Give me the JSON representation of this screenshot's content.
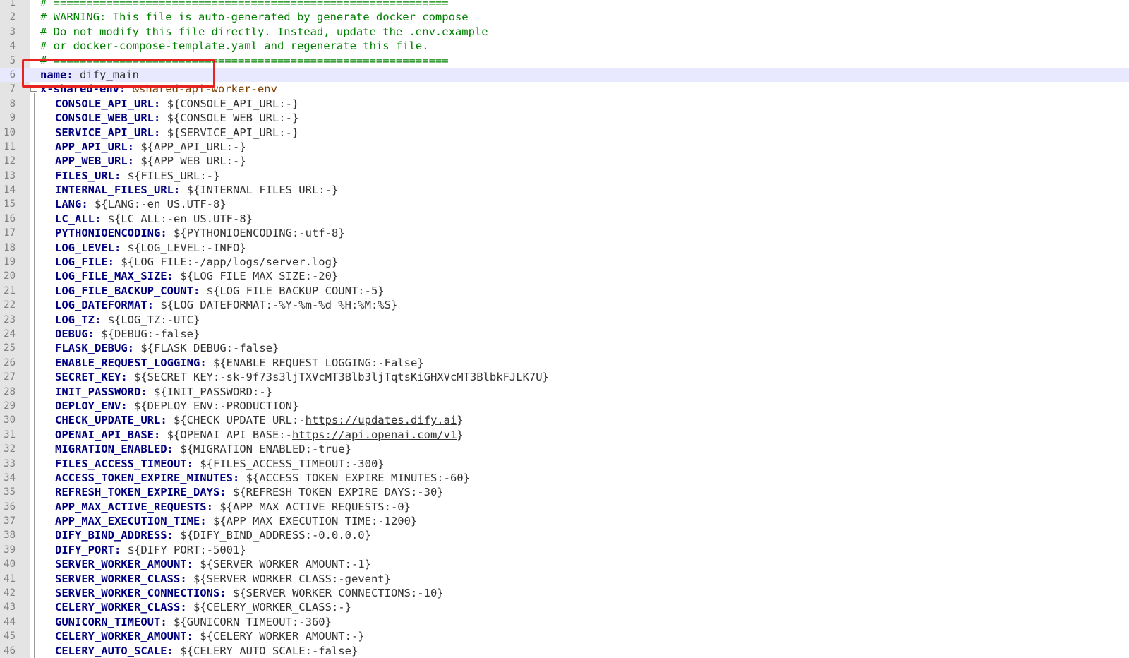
{
  "editor": {
    "highlighted_line": 6,
    "lines": [
      {
        "num": "1",
        "type": "comment",
        "text": "# ============================================================"
      },
      {
        "num": "2",
        "type": "comment",
        "text": "# WARNING: This file is auto-generated by generate_docker_compose"
      },
      {
        "num": "3",
        "type": "comment",
        "text": "# Do not modify this file directly. Instead, update the .env.example"
      },
      {
        "num": "4",
        "type": "comment",
        "text": "# or docker-compose-template.yaml and regenerate this file."
      },
      {
        "num": "5",
        "type": "comment",
        "text": "# ============================================================"
      },
      {
        "num": "6",
        "type": "kv",
        "indent": 0,
        "key": "name",
        "value": "dify_main"
      },
      {
        "num": "7",
        "type": "anchor",
        "indent": 0,
        "key": "x-shared-env",
        "value": "&shared-api-worker-env"
      },
      {
        "num": "8",
        "type": "kv",
        "indent": 1,
        "key": "CONSOLE_API_URL",
        "value": "${CONSOLE_API_URL:-}"
      },
      {
        "num": "9",
        "type": "kv",
        "indent": 1,
        "key": "CONSOLE_WEB_URL",
        "value": "${CONSOLE_WEB_URL:-}"
      },
      {
        "num": "10",
        "type": "kv",
        "indent": 1,
        "key": "SERVICE_API_URL",
        "value": "${SERVICE_API_URL:-}"
      },
      {
        "num": "11",
        "type": "kv",
        "indent": 1,
        "key": "APP_API_URL",
        "value": "${APP_API_URL:-}"
      },
      {
        "num": "12",
        "type": "kv",
        "indent": 1,
        "key": "APP_WEB_URL",
        "value": "${APP_WEB_URL:-}"
      },
      {
        "num": "13",
        "type": "kv",
        "indent": 1,
        "key": "FILES_URL",
        "value": "${FILES_URL:-}"
      },
      {
        "num": "14",
        "type": "kv",
        "indent": 1,
        "key": "INTERNAL_FILES_URL",
        "value": "${INTERNAL_FILES_URL:-}"
      },
      {
        "num": "15",
        "type": "kv",
        "indent": 1,
        "key": "LANG",
        "value": "${LANG:-en_US.UTF-8}"
      },
      {
        "num": "16",
        "type": "kv",
        "indent": 1,
        "key": "LC_ALL",
        "value": "${LC_ALL:-en_US.UTF-8}"
      },
      {
        "num": "17",
        "type": "kv",
        "indent": 1,
        "key": "PYTHONIOENCODING",
        "value": "${PYTHONIOENCODING:-utf-8}"
      },
      {
        "num": "18",
        "type": "kv",
        "indent": 1,
        "key": "LOG_LEVEL",
        "value": "${LOG_LEVEL:-INFO}"
      },
      {
        "num": "19",
        "type": "kv",
        "indent": 1,
        "key": "LOG_FILE",
        "value": "${LOG_FILE:-/app/logs/server.log}"
      },
      {
        "num": "20",
        "type": "kv",
        "indent": 1,
        "key": "LOG_FILE_MAX_SIZE",
        "value": "${LOG_FILE_MAX_SIZE:-20}"
      },
      {
        "num": "21",
        "type": "kv",
        "indent": 1,
        "key": "LOG_FILE_BACKUP_COUNT",
        "value": "${LOG_FILE_BACKUP_COUNT:-5}"
      },
      {
        "num": "22",
        "type": "kv",
        "indent": 1,
        "key": "LOG_DATEFORMAT",
        "value": "${LOG_DATEFORMAT:-%Y-%m-%d %H:%M:%S}"
      },
      {
        "num": "23",
        "type": "kv",
        "indent": 1,
        "key": "LOG_TZ",
        "value": "${LOG_TZ:-UTC}"
      },
      {
        "num": "24",
        "type": "kv",
        "indent": 1,
        "key": "DEBUG",
        "value": "${DEBUG:-false}"
      },
      {
        "num": "25",
        "type": "kv",
        "indent": 1,
        "key": "FLASK_DEBUG",
        "value": "${FLASK_DEBUG:-false}"
      },
      {
        "num": "26",
        "type": "kv",
        "indent": 1,
        "key": "ENABLE_REQUEST_LOGGING",
        "value": "${ENABLE_REQUEST_LOGGING:-False}"
      },
      {
        "num": "27",
        "type": "kv",
        "indent": 1,
        "key": "SECRET_KEY",
        "value": "${SECRET_KEY:-sk-9f73s3ljTXVcMT3Blb3ljTqtsKiGHXVcMT3BlbkFJLK7U}"
      },
      {
        "num": "28",
        "type": "kv",
        "indent": 1,
        "key": "INIT_PASSWORD",
        "value": "${INIT_PASSWORD:-}"
      },
      {
        "num": "29",
        "type": "kv",
        "indent": 1,
        "key": "DEPLOY_ENV",
        "value": "${DEPLOY_ENV:-PRODUCTION}"
      },
      {
        "num": "30",
        "type": "url",
        "indent": 1,
        "key": "CHECK_UPDATE_URL",
        "prefix": "${CHECK_UPDATE_URL:-",
        "url": "https://updates.dify.ai",
        "suffix": "}"
      },
      {
        "num": "31",
        "type": "url",
        "indent": 1,
        "key": "OPENAI_API_BASE",
        "prefix": "${OPENAI_API_BASE:-",
        "url": "https://api.openai.com/v1",
        "suffix": "}"
      },
      {
        "num": "32",
        "type": "kv",
        "indent": 1,
        "key": "MIGRATION_ENABLED",
        "value": "${MIGRATION_ENABLED:-true}"
      },
      {
        "num": "33",
        "type": "kv",
        "indent": 1,
        "key": "FILES_ACCESS_TIMEOUT",
        "value": "${FILES_ACCESS_TIMEOUT:-300}"
      },
      {
        "num": "34",
        "type": "kv",
        "indent": 1,
        "key": "ACCESS_TOKEN_EXPIRE_MINUTES",
        "value": "${ACCESS_TOKEN_EXPIRE_MINUTES:-60}"
      },
      {
        "num": "35",
        "type": "kv",
        "indent": 1,
        "key": "REFRESH_TOKEN_EXPIRE_DAYS",
        "value": "${REFRESH_TOKEN_EXPIRE_DAYS:-30}"
      },
      {
        "num": "36",
        "type": "kv",
        "indent": 1,
        "key": "APP_MAX_ACTIVE_REQUESTS",
        "value": "${APP_MAX_ACTIVE_REQUESTS:-0}"
      },
      {
        "num": "37",
        "type": "kv",
        "indent": 1,
        "key": "APP_MAX_EXECUTION_TIME",
        "value": "${APP_MAX_EXECUTION_TIME:-1200}"
      },
      {
        "num": "38",
        "type": "kv",
        "indent": 1,
        "key": "DIFY_BIND_ADDRESS",
        "value": "${DIFY_BIND_ADDRESS:-0.0.0.0}"
      },
      {
        "num": "39",
        "type": "kv",
        "indent": 1,
        "key": "DIFY_PORT",
        "value": "${DIFY_PORT:-5001}"
      },
      {
        "num": "40",
        "type": "kv",
        "indent": 1,
        "key": "SERVER_WORKER_AMOUNT",
        "value": "${SERVER_WORKER_AMOUNT:-1}"
      },
      {
        "num": "41",
        "type": "kv",
        "indent": 1,
        "key": "SERVER_WORKER_CLASS",
        "value": "${SERVER_WORKER_CLASS:-gevent}"
      },
      {
        "num": "42",
        "type": "kv",
        "indent": 1,
        "key": "SERVER_WORKER_CONNECTIONS",
        "value": "${SERVER_WORKER_CONNECTIONS:-10}"
      },
      {
        "num": "43",
        "type": "kv",
        "indent": 1,
        "key": "CELERY_WORKER_CLASS",
        "value": "${CELERY_WORKER_CLASS:-}"
      },
      {
        "num": "44",
        "type": "kv",
        "indent": 1,
        "key": "GUNICORN_TIMEOUT",
        "value": "${GUNICORN_TIMEOUT:-360}"
      },
      {
        "num": "45",
        "type": "kv",
        "indent": 1,
        "key": "CELERY_WORKER_AMOUNT",
        "value": "${CELERY_WORKER_AMOUNT:-}"
      },
      {
        "num": "46",
        "type": "kv",
        "indent": 1,
        "key": "CELERY_AUTO_SCALE",
        "value": "${CELERY_AUTO_SCALE:-false}"
      }
    ]
  },
  "colors": {
    "comment": "#008000",
    "key": "#000080",
    "value": "#333333",
    "anchor": "#804000",
    "current_line": "#e8e8ff",
    "annotation_box": "#e8231f",
    "gutter": "#e4e4e4"
  }
}
